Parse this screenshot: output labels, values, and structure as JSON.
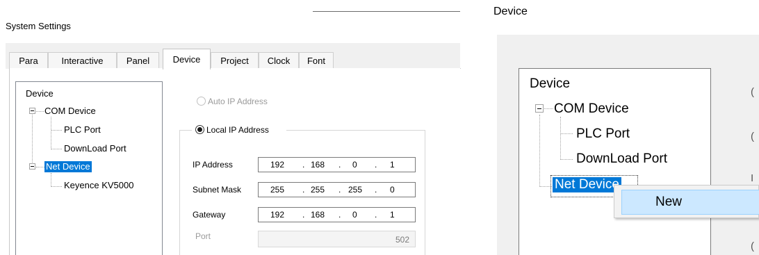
{
  "settings": {
    "title": "System Settings",
    "tabs": [
      {
        "label": "Para"
      },
      {
        "label": "Interactive"
      },
      {
        "label": "Panel"
      },
      {
        "label": "Device"
      },
      {
        "label": "Project"
      },
      {
        "label": "Clock"
      },
      {
        "label": "Font"
      }
    ],
    "active_tab": "Device",
    "tree": {
      "root": "Device",
      "com_device": "COM Device",
      "plc_port": "PLC Port",
      "download_port": "DownLoad Port",
      "net_device": "Net Device",
      "keyence": "Keyence KV5000"
    },
    "auto_ip_label": "Auto IP Address",
    "local_ip_label": "Local IP Address",
    "ip_address": {
      "label": "IP Address",
      "octets": [
        "192",
        "168",
        "0",
        "1"
      ]
    },
    "subnet_mask": {
      "label": "Subnet Mask",
      "octets": [
        "255",
        "255",
        "255",
        "0"
      ]
    },
    "gateway": {
      "label": "Gateway",
      "octets": [
        "192",
        "168",
        "0",
        "1"
      ]
    },
    "port": {
      "label": "Port",
      "value": "502"
    }
  },
  "zoom": {
    "title": "Device",
    "tree": {
      "root": "Device",
      "com_device": "COM Device",
      "plc_port": "PLC Port",
      "download_port": "DownLoad Port",
      "net_device": "Net Device"
    },
    "context_menu": {
      "new_label": "New"
    }
  },
  "colors": {
    "selection": "#0078d7",
    "menu_hover": "#cce8ff"
  }
}
